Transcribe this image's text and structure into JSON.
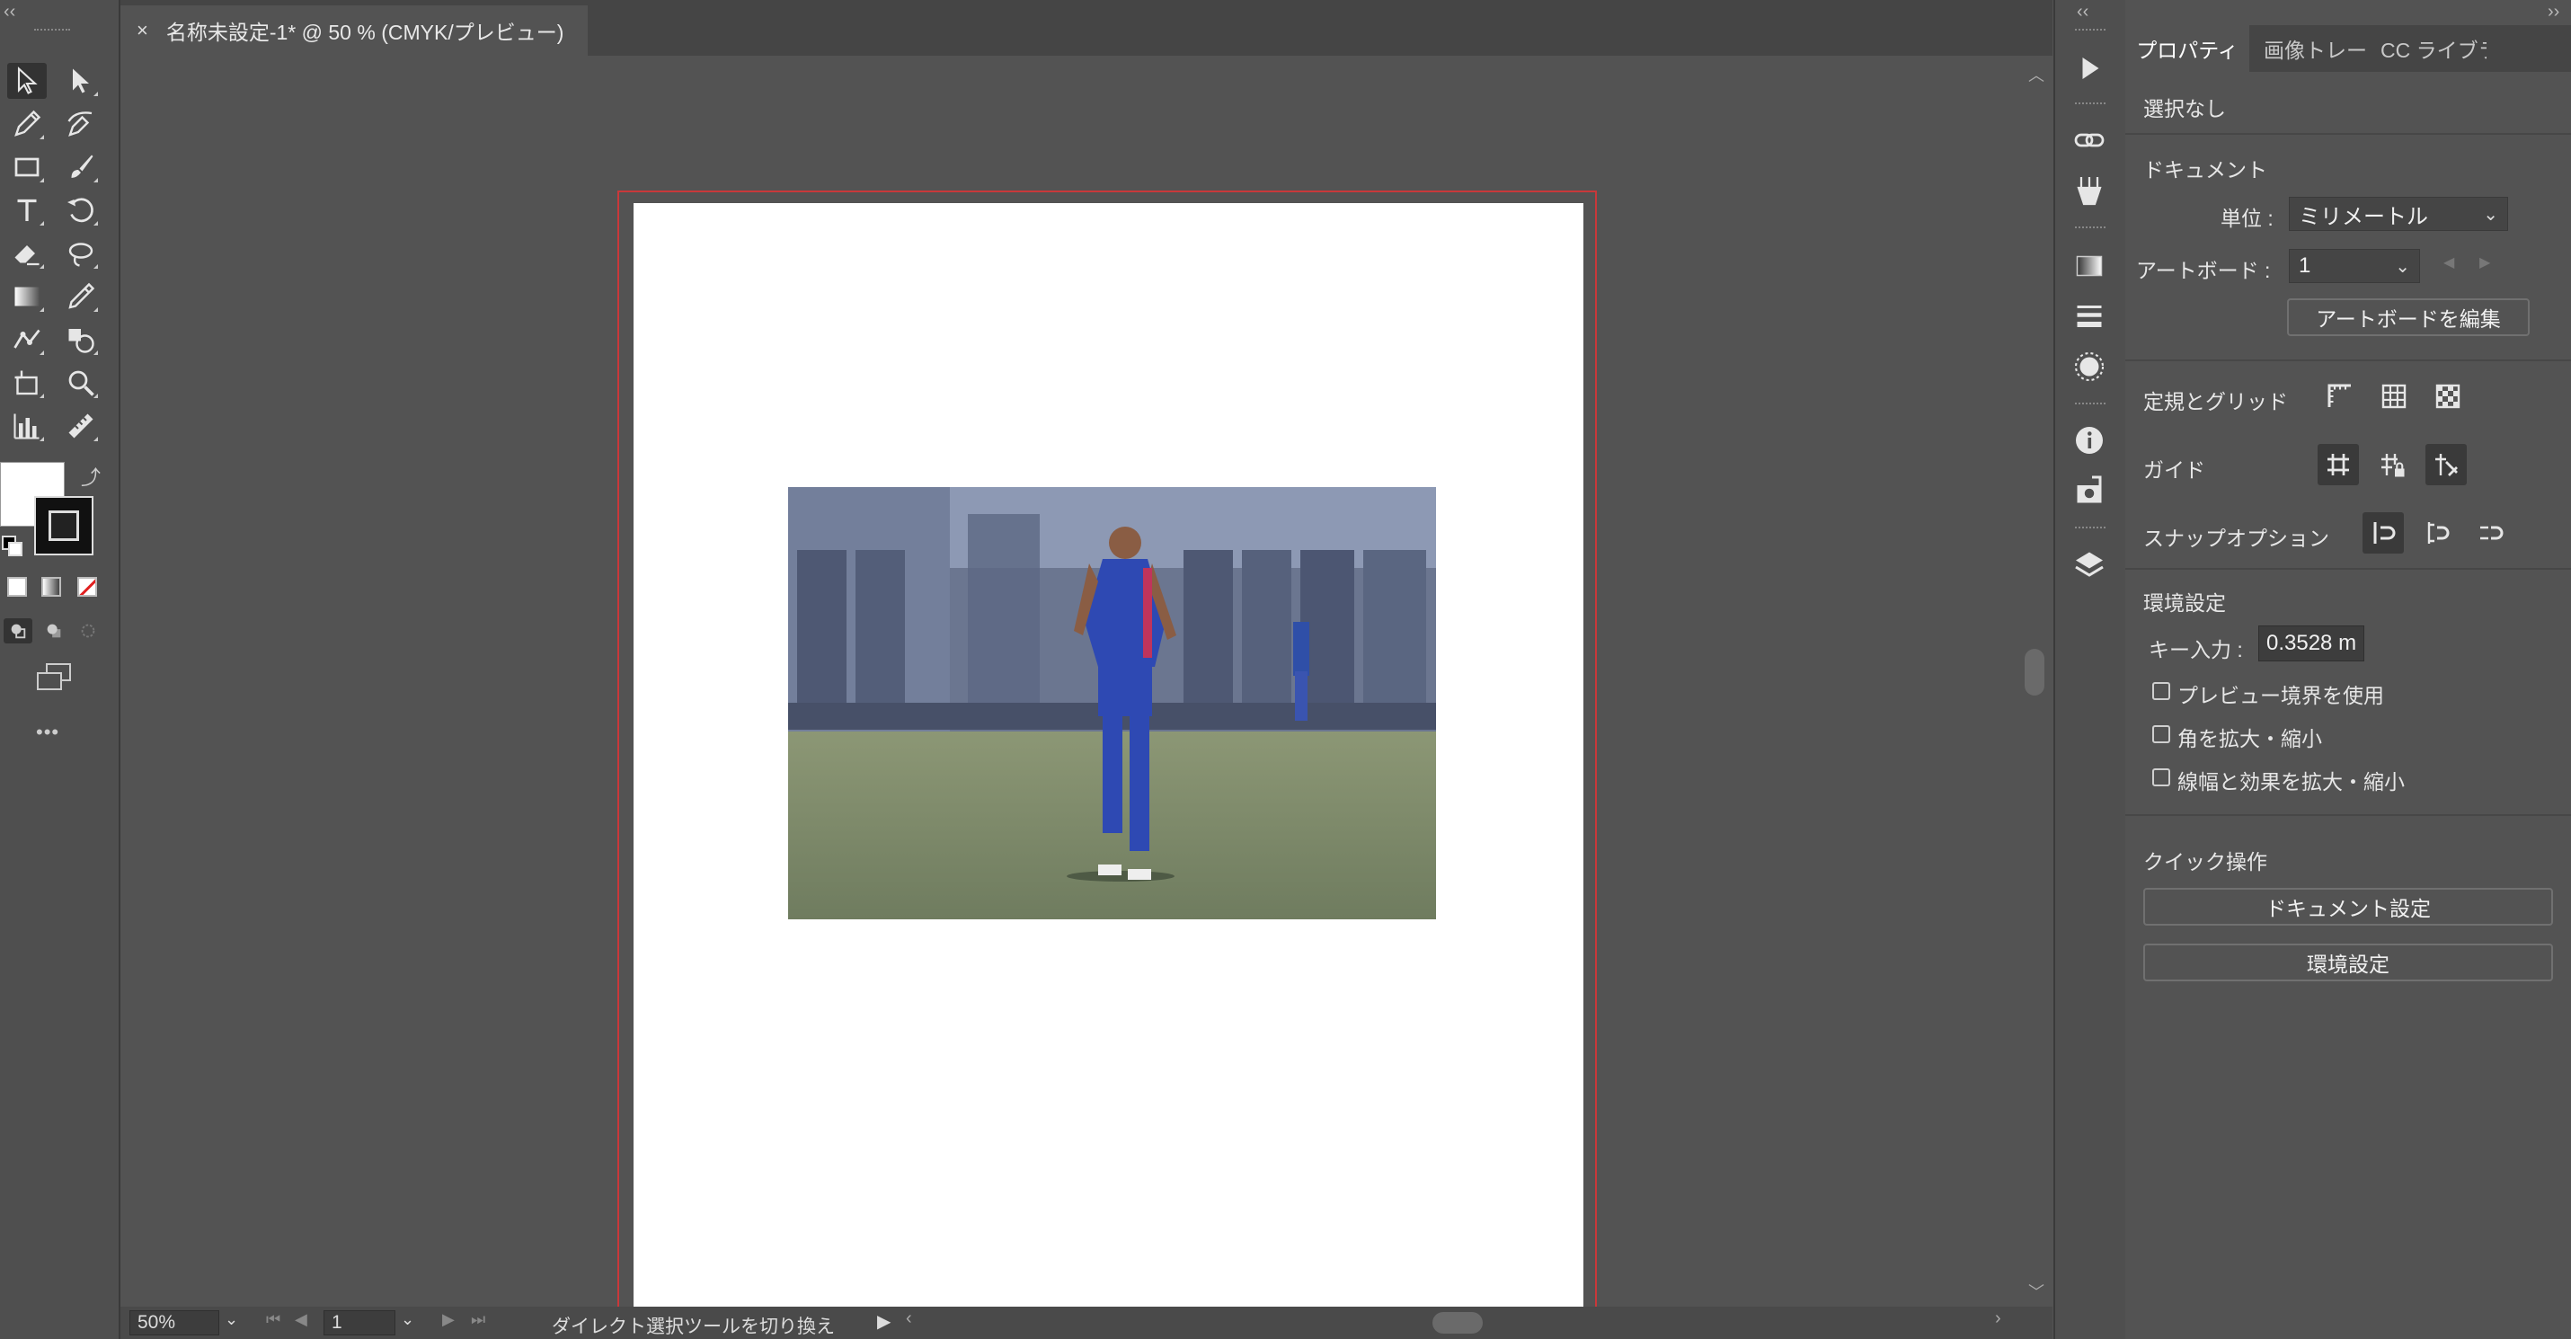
{
  "document_tab": {
    "title": "名称未設定-1* @ 50 % (CMYK/プレビュー)",
    "close_glyph": "×"
  },
  "toolbar": {
    "tools": [
      {
        "name": "selection-tool-icon"
      },
      {
        "name": "direct-selection-tool-icon"
      },
      {
        "name": "pen-tool-icon"
      },
      {
        "name": "curvature-tool-icon"
      },
      {
        "name": "rectangle-tool-icon"
      },
      {
        "name": "paintbrush-tool-icon"
      },
      {
        "name": "type-tool-icon"
      },
      {
        "name": "rotate-tool-icon"
      },
      {
        "name": "eraser-tool-icon"
      },
      {
        "name": "lasso-tool-icon"
      },
      {
        "name": "gradient-tool-icon"
      },
      {
        "name": "eyedropper-tool-icon"
      },
      {
        "name": "puppet-warp-tool-icon"
      },
      {
        "name": "shape-builder-tool-icon"
      },
      {
        "name": "artboard-tool-icon"
      },
      {
        "name": "zoom-tool-icon"
      },
      {
        "name": "graph-tool-icon"
      },
      {
        "name": "measure-tool-icon"
      }
    ],
    "more_glyph": "•••",
    "fill_color": "#ffffff",
    "stroke_color": "#111111"
  },
  "status_bar": {
    "zoom": "50%",
    "artboard_number": "1",
    "status_text": "ダイレクト選択ツールを切り換え"
  },
  "right_strip_icons": [
    "play-icon",
    "links-icon",
    "puppet-icon",
    "gradient-panel-icon",
    "stroke-panel-icon",
    "appearance-icon",
    "info-icon",
    "export-icon",
    "layers-icon"
  ],
  "properties_panel": {
    "tabs": [
      "プロパティ",
      "画像トレース",
      "CC ライブラリ"
    ],
    "selection_state": "選択なし",
    "document_section": {
      "heading": "ドキュメント",
      "units_label": "単位 :",
      "units_value": "ミリメートル",
      "artboard_label": "アートボード :",
      "artboard_value": "1",
      "edit_artboard_button": "アートボードを編集"
    },
    "rulers_grids_label": "定規とグリッド",
    "guides_label": "ガイド",
    "snap_options_label": "スナップオプション",
    "preferences": {
      "heading": "環境設定",
      "key_input_label": "キー入力 :",
      "key_input_value": "0.3528 m",
      "checkboxes": [
        "プレビュー境界を使用",
        "角を拡大・縮小",
        "線幅と効果を拡大・縮小"
      ]
    },
    "quick_actions": {
      "heading": "クイック操作",
      "document_setup_button": "ドキュメント設定",
      "preferences_button": "環境設定"
    }
  },
  "colors": {
    "app_background": "#535353",
    "artboard": "#ffffff",
    "bleed_guide": "#c9383a"
  }
}
